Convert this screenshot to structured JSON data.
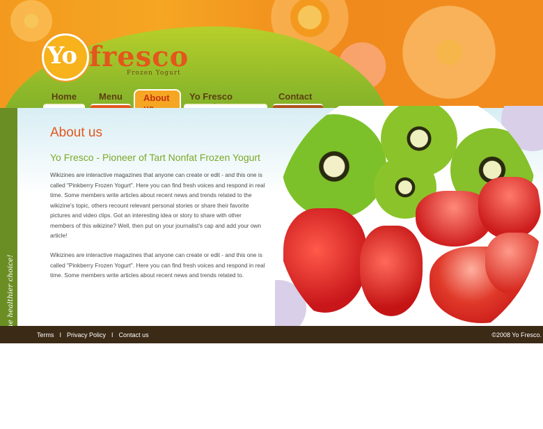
{
  "brand": {
    "logo_yo": "Yo",
    "logo_name": "fresco",
    "tagline": "Frozen Yogurt"
  },
  "nav": {
    "items": [
      {
        "label": "Home",
        "active": false
      },
      {
        "label": "Menu",
        "active": false
      },
      {
        "label": "About us",
        "active": true
      },
      {
        "label": "Yo Fresco Location",
        "active": false
      },
      {
        "label": "Contact us",
        "active": false
      }
    ]
  },
  "sidebar": {
    "slogan": "Yo, Let's make the healthier choice!"
  },
  "main": {
    "title": "About us",
    "subtitle": "Yo Fresco - Pioneer of Tart Nonfat Frozen Yogurt",
    "paragraphs": [
      "Wikizines are interactive magazines that anyone can create or edit - and this one is called \"Pinkberry Frozen Yogurt\". Here you can find fresh voices and respond in real time. Some members write articles about recent news and trends related to the wikizine's topic, others recount relevant personal stories or share their favorite pictures and video clips. Got an interesting idea or story to share with other members of this wikizine? Well, then put on your journalist's cap and add your own article!",
      "Wikizines are interactive magazines that anyone can create or edit - and this one is called \"Pinkberry Frozen Yogurt\". Here you can find fresh voices and respond in real time. Some members write articles about recent news and trends related to."
    ]
  },
  "footer": {
    "links": [
      "Terms",
      "Privacy Policy",
      "Contact us"
    ],
    "separator": "I",
    "copyright": "©2008 Yo Fresco."
  },
  "colors": {
    "orange": "#f08a1c",
    "green": "#8db82a",
    "title_orange": "#e3561c",
    "subtitle_green": "#7aa827",
    "footer_brown": "#3b2a16"
  }
}
